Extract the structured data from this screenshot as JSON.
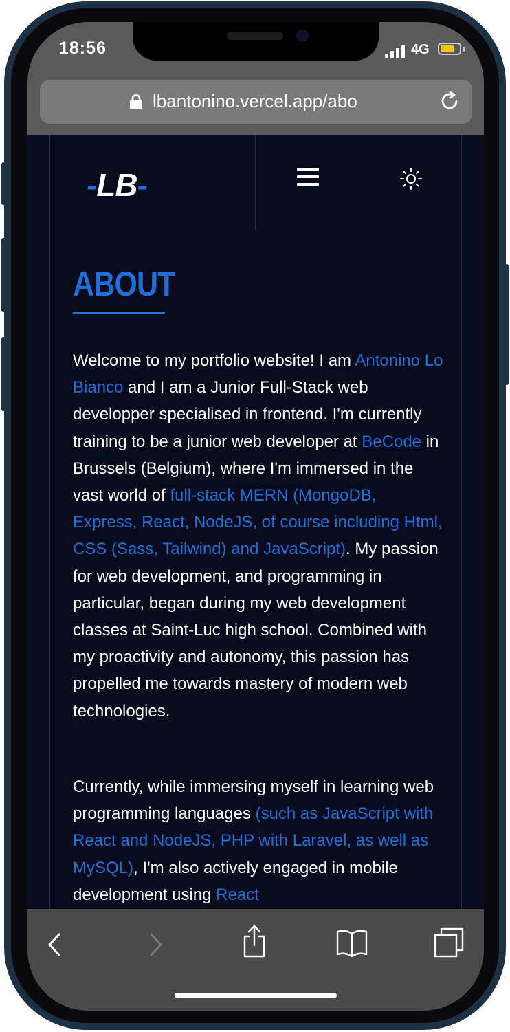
{
  "status_bar": {
    "time": "18:56",
    "network": "4G"
  },
  "browser": {
    "url": "lbantonino.vercel.app/abo"
  },
  "site_header": {
    "logo_dash_left": "-",
    "logo_text": "LB",
    "logo_dash_right": "-"
  },
  "about": {
    "title": "ABOUT",
    "paragraph1": [
      {
        "t": "Welcome to my portfolio website! I am ",
        "hl": false
      },
      {
        "t": "Antonino Lo Bianco",
        "hl": true
      },
      {
        "t": " and I am a Junior Full-Stack web developper specialised in frontend. I'm currently training to be a junior web developer at ",
        "hl": false
      },
      {
        "t": "BeCode",
        "hl": true
      },
      {
        "t": " in Brussels (Belgium), where I'm immersed in the vast world of ",
        "hl": false
      },
      {
        "t": "full-stack MERN (MongoDB, Express, React, NodeJS, of course including Html, CSS (Sass, Tailwind) and JavaScript)",
        "hl": true
      },
      {
        "t": ". My passion for web development, and programming in particular, began during my web development classes at Saint-Luc high school. Combined with my proactivity and autonomy, this passion has propelled me towards mastery of modern web technologies.",
        "hl": false
      }
    ],
    "paragraph2": [
      {
        "t": "Currently, while immersing myself in learning web programming languages ",
        "hl": false
      },
      {
        "t": "(such as JavaScript with React and NodeJS, PHP with Laravel, as well as MySQL)",
        "hl": true
      },
      {
        "t": ", I'm also actively engaged in mobile development using ",
        "hl": false
      },
      {
        "t": "React",
        "hl": true
      }
    ]
  },
  "colors": {
    "accent": "#1e6fd9",
    "background": "#070b1c",
    "frame": "#1d3144"
  },
  "icons": [
    "lock-icon",
    "reload-icon",
    "menu-icon",
    "sun-icon",
    "back-icon",
    "forward-icon",
    "share-icon",
    "bookmarks-icon",
    "tabs-icon"
  ]
}
